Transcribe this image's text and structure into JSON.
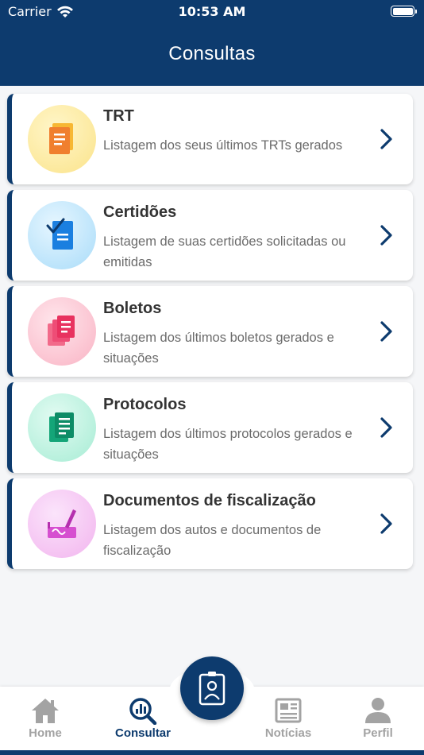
{
  "status_bar": {
    "carrier": "Carrier",
    "time": "10:53 AM"
  },
  "header": {
    "title": "Consultas"
  },
  "colors": {
    "primary": "#0d3b6e",
    "inactive": "#a3a3a3"
  },
  "items": [
    {
      "title": "TRT",
      "description": "Listagem dos seus últimos TRTs gerados",
      "icon": "trt-document-icon"
    },
    {
      "title": "Certidões",
      "description": "Listagem de suas certidões solicitadas ou emitidas",
      "icon": "certificate-icon"
    },
    {
      "title": "Boletos",
      "description": "Listagem dos últimos boletos gerados e situações",
      "icon": "invoice-stack-icon"
    },
    {
      "title": "Protocolos",
      "description": "Listagem dos últimos protocolos gerados e situações",
      "icon": "protocol-stack-icon"
    },
    {
      "title": "Documentos de fiscalização",
      "description": "Listagem dos autos  e documentos de fiscalização",
      "icon": "signature-document-icon"
    }
  ],
  "tabbar": {
    "home": "Home",
    "consultar": "Consultar",
    "noticias": "Notícias",
    "perfil": "Perfil",
    "center_icon": "id-badge-icon",
    "active": "consultar"
  }
}
